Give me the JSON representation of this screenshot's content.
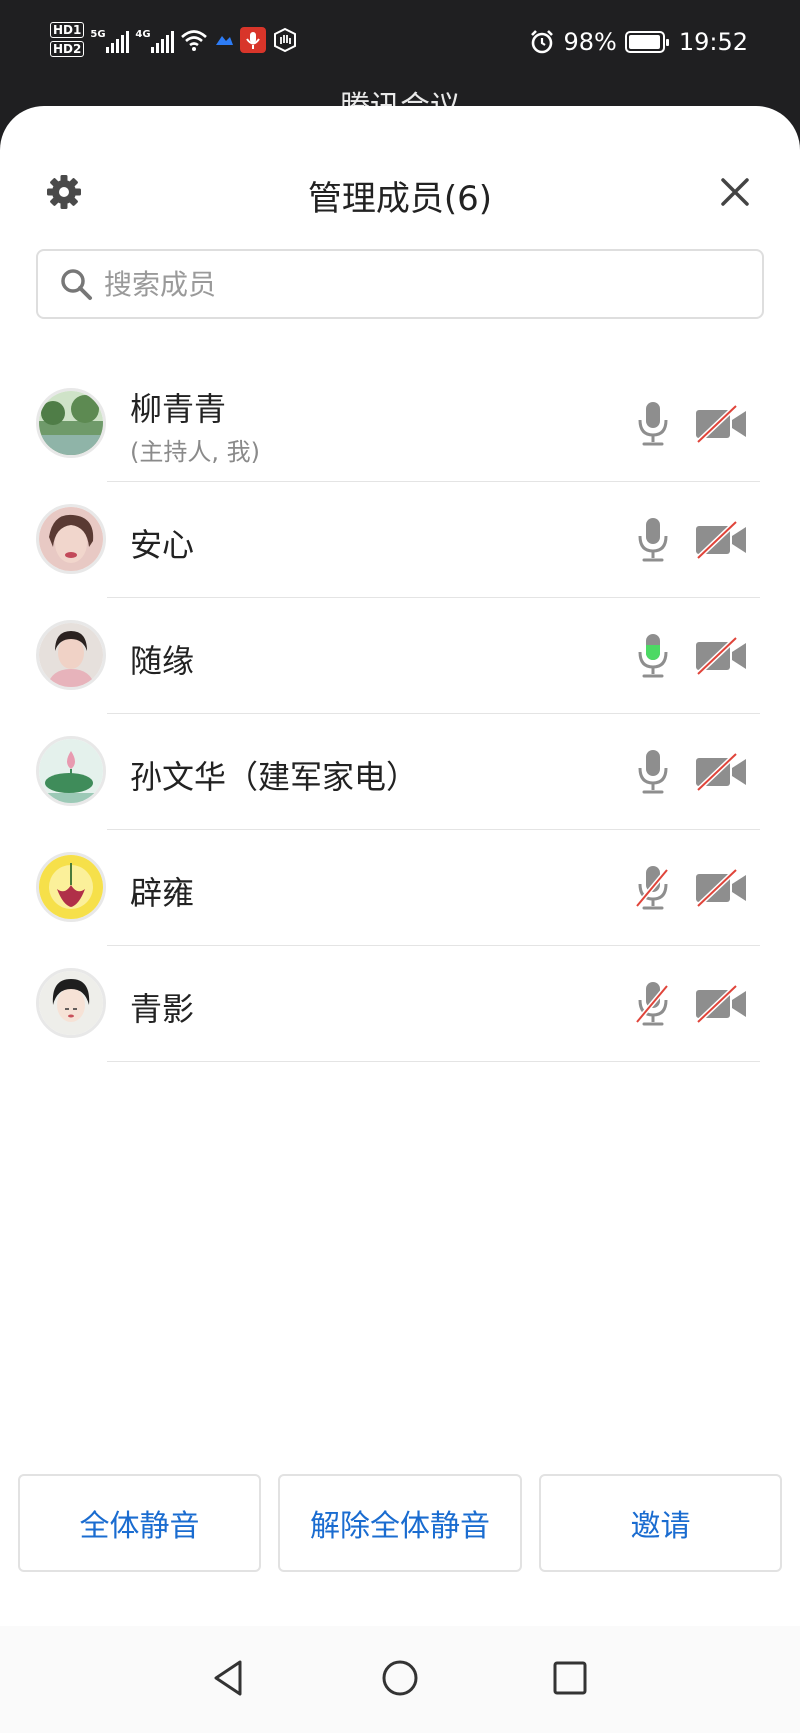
{
  "status_bar": {
    "hd1": "HD1",
    "hd2": "HD2",
    "net1": "5G",
    "net2": "4G",
    "battery": "98%",
    "time": "19:52"
  },
  "behind_title": "腾讯会议",
  "header": {
    "title": "管理成员(6)"
  },
  "search": {
    "placeholder": "搜索成员"
  },
  "members": [
    {
      "name": "柳青青",
      "sub": "(主持人, 我)",
      "mic": "off",
      "video": "off"
    },
    {
      "name": "安心",
      "sub": "",
      "mic": "off",
      "video": "off"
    },
    {
      "name": "随缘",
      "sub": "",
      "mic": "speaking",
      "video": "off"
    },
    {
      "name": "孙文华（建军家电）",
      "sub": "",
      "mic": "off",
      "video": "off"
    },
    {
      "name": "辟雍",
      "sub": "",
      "mic": "muted",
      "video": "off"
    },
    {
      "name": "青影",
      "sub": "",
      "mic": "muted",
      "video": "off"
    }
  ],
  "actions": {
    "mute_all": "全体静音",
    "unmute_all": "解除全体静音",
    "invite": "邀请"
  },
  "colors": {
    "accent": "#1a6cd0",
    "speaking": "#4cd964",
    "muted_slash": "#e0443a"
  }
}
